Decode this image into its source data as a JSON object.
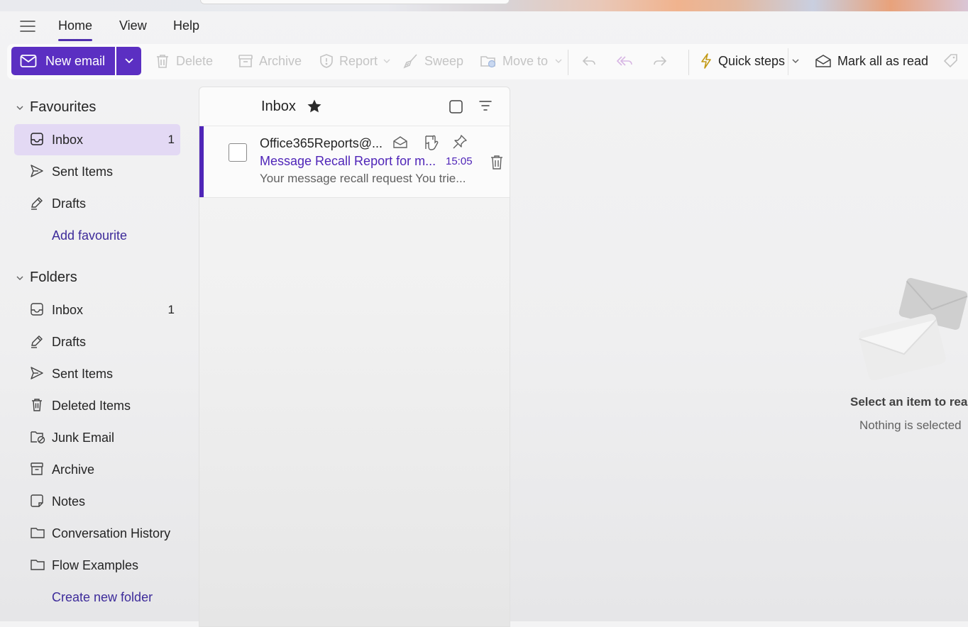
{
  "menu": {
    "tabs": [
      "Home",
      "View",
      "Help"
    ]
  },
  "ribbon": {
    "new_email": "New email",
    "delete": "Delete",
    "archive": "Archive",
    "report": "Report",
    "sweep": "Sweep",
    "move_to": "Move to",
    "quick_steps": "Quick steps",
    "mark_all_read": "Mark all as read"
  },
  "nav": {
    "favourites": {
      "title": "Favourites",
      "items": [
        {
          "label": "Inbox",
          "count": "1"
        },
        {
          "label": "Sent Items"
        },
        {
          "label": "Drafts"
        }
      ],
      "add_link": "Add favourite"
    },
    "folders": {
      "title": "Folders",
      "items": [
        {
          "label": "Inbox",
          "count": "1"
        },
        {
          "label": "Drafts"
        },
        {
          "label": "Sent Items"
        },
        {
          "label": "Deleted Items"
        },
        {
          "label": "Junk Email"
        },
        {
          "label": "Archive"
        },
        {
          "label": "Notes"
        },
        {
          "label": "Conversation History"
        },
        {
          "label": "Flow Examples"
        }
      ],
      "create_link": "Create new folder"
    }
  },
  "list": {
    "title": "Inbox",
    "messages": [
      {
        "from": "Office365Reports@...",
        "subject": "Message Recall Report for m...",
        "time": "15:05",
        "preview": "Your message recall request You trie..."
      }
    ]
  },
  "reading": {
    "title": "Select an item to read",
    "subtitle": "Nothing is selected"
  },
  "colors": {
    "accent": "#5b2fc2",
    "selected": "#e3d9f4",
    "link": "#3d2b9a"
  }
}
